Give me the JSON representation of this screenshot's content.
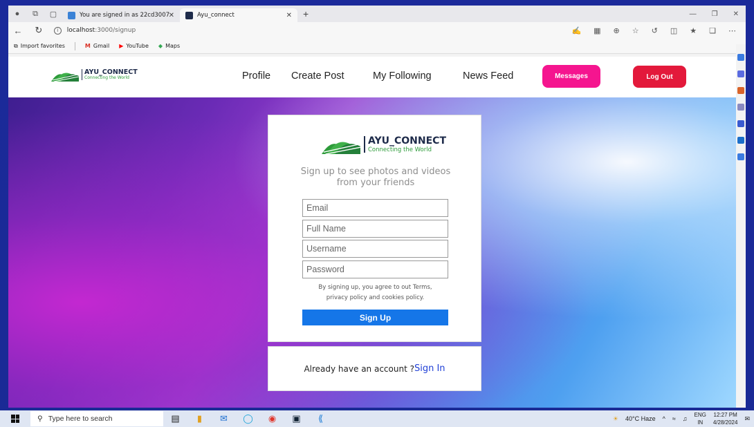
{
  "browser": {
    "tabs": [
      {
        "label": "You are signed in as 22cd3007",
        "active": false
      },
      {
        "label": "Ayu_connect",
        "active": true
      }
    ],
    "url_host": "localhost",
    "url_path": ":3000/signup",
    "favorites": [
      {
        "label": "Import favorites",
        "icon": "import-icon"
      },
      {
        "label": "Gmail",
        "icon": "gmail-icon"
      },
      {
        "label": "YouTube",
        "icon": "youtube-icon"
      },
      {
        "label": "Maps",
        "icon": "maps-icon"
      }
    ]
  },
  "header": {
    "brand_title": "AYU_CONNECT",
    "brand_subtitle": "Connecting the World",
    "nav": {
      "profile": "Profile",
      "create_post": "Create Post",
      "my_following": "My Following",
      "news_feed": "News Feed"
    },
    "messages_label": "Messages",
    "logout_label": "Log Out",
    "colors": {
      "messages": "#f5158f",
      "logout": "#e3193b"
    }
  },
  "signup": {
    "brand_title": "AYU_CONNECT",
    "brand_subtitle": "Connecting the World",
    "tagline": "Sign up to see photos and videos from your friends",
    "fields": {
      "email": "Email",
      "full_name": "Full Name",
      "username": "Username",
      "password": "Password"
    },
    "terms_line1": "By signing up, you agree to out Terms,",
    "terms_line2": "privacy policy and cookies policy.",
    "button_label": "Sign Up",
    "button_color": "#1576e8"
  },
  "signin": {
    "prompt": "Already have an account ?",
    "link_label": "Sign In"
  },
  "taskbar": {
    "search_placeholder": "Type here to search",
    "weather": "40°C  Haze",
    "lang_top": "ENG",
    "lang_bottom": "IN",
    "time": "12:27 PM",
    "date": "4/28/2024"
  }
}
